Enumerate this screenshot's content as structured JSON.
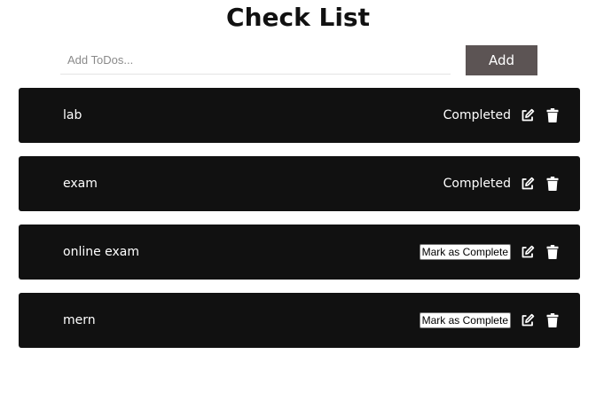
{
  "header": {
    "title": "Check List"
  },
  "add_form": {
    "placeholder": "Add ToDos...",
    "value": "",
    "button_label": "Add"
  },
  "todos": [
    {
      "text": "lab",
      "completed": true,
      "status_label": "Completed"
    },
    {
      "text": "exam",
      "completed": true,
      "status_label": "Completed"
    },
    {
      "text": "online exam",
      "completed": false,
      "status_label": "Mark as Complete"
    },
    {
      "text": "mern",
      "completed": false,
      "status_label": "Mark as Complete"
    }
  ],
  "icons": {
    "edit": "edit-icon",
    "delete": "trash-icon"
  },
  "colors": {
    "item_background": "#111111",
    "item_text": "#ffffff",
    "add_button": "#5c5454",
    "title": "#111111"
  }
}
